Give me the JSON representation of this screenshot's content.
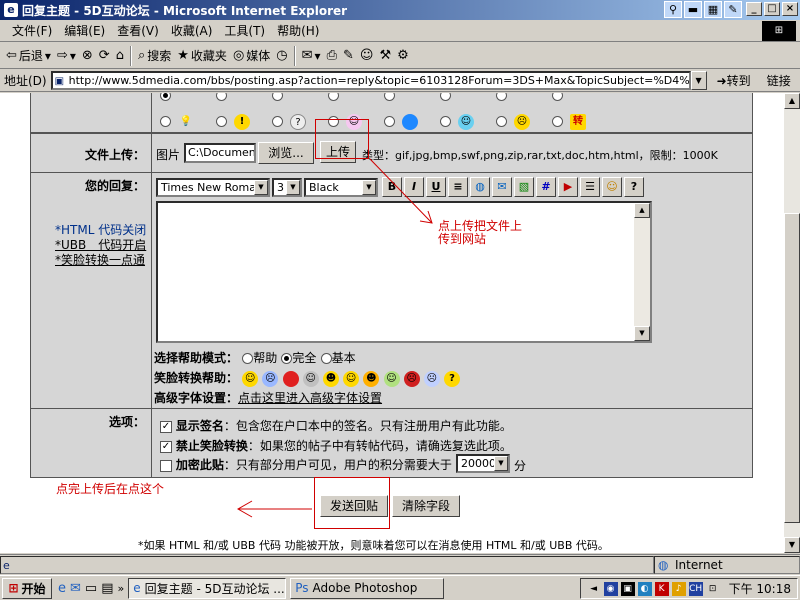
{
  "window": {
    "title": "回复主题 - 5D互动论坛 - Microsoft Internet Explorer",
    "buttons": {
      "min": "_",
      "max": "□",
      "close": "×"
    }
  },
  "menu": [
    "文件(F)",
    "编辑(E)",
    "查看(V)",
    "收藏(A)",
    "工具(T)",
    "帮助(H)"
  ],
  "toolbar": {
    "back": "后退",
    "search": "搜索",
    "favorites": "收藏夹",
    "media": "媒体"
  },
  "address": {
    "label": "地址(D)",
    "url": "http://www.5dmedia.com/bbs/posting.asp?action=reply&topic=6103128Forum=3DS+Max&TopicSubject=%D4%F5%C3%B4",
    "go": "转到",
    "links": "链接"
  },
  "form": {
    "upload": {
      "label": "文件上传：",
      "prefix": "图片",
      "file_value": "C:\\Document",
      "browse": "浏览...",
      "upload_button": "上传",
      "types": "类型：gif,jpg,bmp,swf,png,zip,rar,txt,doc,htm,html，限制：1000K"
    },
    "reply": {
      "label": "您的回复：",
      "notes": [
        "*HTML 代码关闭",
        "*UBB　代码开启",
        "*笑脸转换一点通"
      ],
      "font": "Times New Roman",
      "size": "3",
      "color": "Black",
      "help_mode_label": "选择帮助模式：",
      "help_modes": [
        "帮助",
        "完全",
        "基本"
      ],
      "smiley_label": "笑脸转换帮助：",
      "adv_label": "高级字体设置：",
      "adv_link": "点击这里进入高级字体设置"
    },
    "options": {
      "label": "选项：",
      "items": [
        {
          "bold": "显示签名",
          "text": "：包含您在户口本中的签名。只有注册用户有此功能。",
          "checked": true
        },
        {
          "bold": "禁止笑脸转换",
          "text": "：如果您的帖子中有转帖代码，请确选复选此项。",
          "checked": true
        },
        {
          "bold": "加密此贴",
          "text": "：只有部分用户可见，用户的积分需要大于",
          "checked": false
        }
      ],
      "points": "20000",
      "points_unit": "分"
    },
    "submit": "发送回贴",
    "clear": "清除字段",
    "footer": "*如果 HTML 和/或 UBB 代码 功能被开放，则意味着您可以在消息使用 HTML 和/或 UBB 代码。"
  },
  "annotations": {
    "upload_note_line1": "点上传把文件上",
    "upload_note_line2": "传到网站",
    "submit_note": "点完上传后在点这个"
  },
  "status": {
    "zone": "Internet"
  },
  "taskbar": {
    "start": "开始",
    "tasks": [
      "回复主题 - 5D互动论坛 ...",
      "Adobe Photoshop"
    ],
    "clock": "下午 10:18"
  },
  "colors": {
    "accent_red": "#d00000",
    "title_blue": "#0a246a",
    "form_bg": "#d6d6d6"
  }
}
